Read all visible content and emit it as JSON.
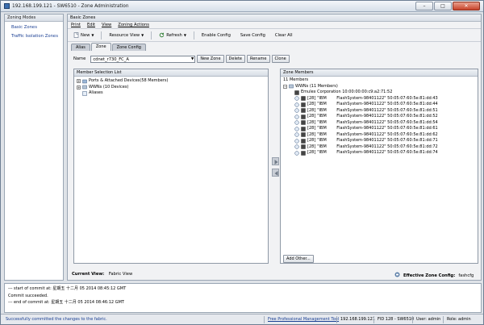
{
  "window": {
    "title": "192.168.199.121 - SW6510 - Zone Administration",
    "controls": {
      "minimize": "–",
      "maximize": "□",
      "close": "✕"
    }
  },
  "left_panel": {
    "header": "Zoning Modes",
    "items": [
      "Basic Zones",
      "Traffic Isolation Zones"
    ]
  },
  "main": {
    "header": "Basic Zones",
    "menu": [
      "Print",
      "Edit",
      "View",
      "Zoning Actions"
    ],
    "toolbar": {
      "new": "New",
      "resource_view": "Resource View",
      "refresh": "Refresh",
      "enable_config": "Enable Config",
      "save_config": "Save Config",
      "clear_all": "Clear All"
    },
    "tabs": [
      "Alias",
      "Zone",
      "Zone Config"
    ],
    "active_tab": "Zone",
    "name_label": "Name",
    "name_value": "cdnet_r730_FC_A",
    "name_buttons": [
      "New Zone",
      "Delete",
      "Rename",
      "Clone"
    ]
  },
  "member_selection": {
    "header": "Member Selection List",
    "rows": [
      {
        "text": "Ports & Attached Devices(58 Members)",
        "expander": "+"
      },
      {
        "text": "WWNs (10 Devices)",
        "expander": "+"
      },
      {
        "text": "Aliases",
        "expander": ""
      }
    ]
  },
  "zone_members": {
    "header": "Zone Members",
    "count": "11 Members",
    "root": "WWNs (11 Members)",
    "emulex": "Emulex Corporation 10:00:00:00:c9:a2:71:52",
    "rows": [
      {
        "idx": "[28]",
        "vendor": "\"IBM",
        "model": "FlashSystem-9840",
        "id": "1122\" 50:05:07:60:5e:81:dd:43"
      },
      {
        "idx": "[28]",
        "vendor": "\"IBM",
        "model": "FlashSystem-9840",
        "id": "1122\" 50:05:07:60:5e:81:dd:44"
      },
      {
        "idx": "[28]",
        "vendor": "\"IBM",
        "model": "FlashSystem-9840",
        "id": "1122\" 50:05:07:60:5e:81:dd:51"
      },
      {
        "idx": "[28]",
        "vendor": "\"IBM",
        "model": "FlashSystem-9840",
        "id": "1122\" 50:05:07:60:5e:81:dd:52"
      },
      {
        "idx": "[28]",
        "vendor": "\"IBM",
        "model": "FlashSystem-9840",
        "id": "1122\" 50:05:07:60:5e:81:dd:54"
      },
      {
        "idx": "[28]",
        "vendor": "\"IBM",
        "model": "FlashSystem-9840",
        "id": "1122\" 50:05:07:60:5e:81:dd:61"
      },
      {
        "idx": "[28]",
        "vendor": "\"IBM",
        "model": "FlashSystem-9840",
        "id": "1122\" 50:05:07:60:5e:81:dd:62"
      },
      {
        "idx": "[28]",
        "vendor": "\"IBM",
        "model": "FlashSystem-9840",
        "id": "1122\" 50:05:07:60:5e:81:dd:71"
      },
      {
        "idx": "[28]",
        "vendor": "\"IBM",
        "model": "FlashSystem-9840",
        "id": "1122\" 50:05:07:60:5e:81:dd:72"
      },
      {
        "idx": "[28]",
        "vendor": "\"IBM",
        "model": "FlashSystem-9840",
        "id": "1122\" 50:05:07:60:5e:81:dd:74"
      }
    ],
    "add_other": "Add Other..."
  },
  "footer": {
    "current_view_label": "Current View:",
    "current_view_value": "Fabric View",
    "effective_label": "Effective Zone Config:",
    "effective_value": "fashcfg"
  },
  "log": [
    "--- start of commit at: 星期五 十二月 05 2014 08:45:12 GMT",
    "Commit succeeded.",
    "--- end of commit at: 星期五 十二月 05 2014 08:46:12 GMT"
  ],
  "status": {
    "message": "Successfully committed the changes to the fabric.",
    "link": "Free Professional Management Tool",
    "ip": "192.168.199.121",
    "fid": "FID 128 - SW6510",
    "user": "User: admin",
    "role": "Role: admin"
  },
  "colors": {
    "link": "#1a3f93",
    "status_msg": "#1a3f93",
    "accent": "#3b6fb0"
  }
}
